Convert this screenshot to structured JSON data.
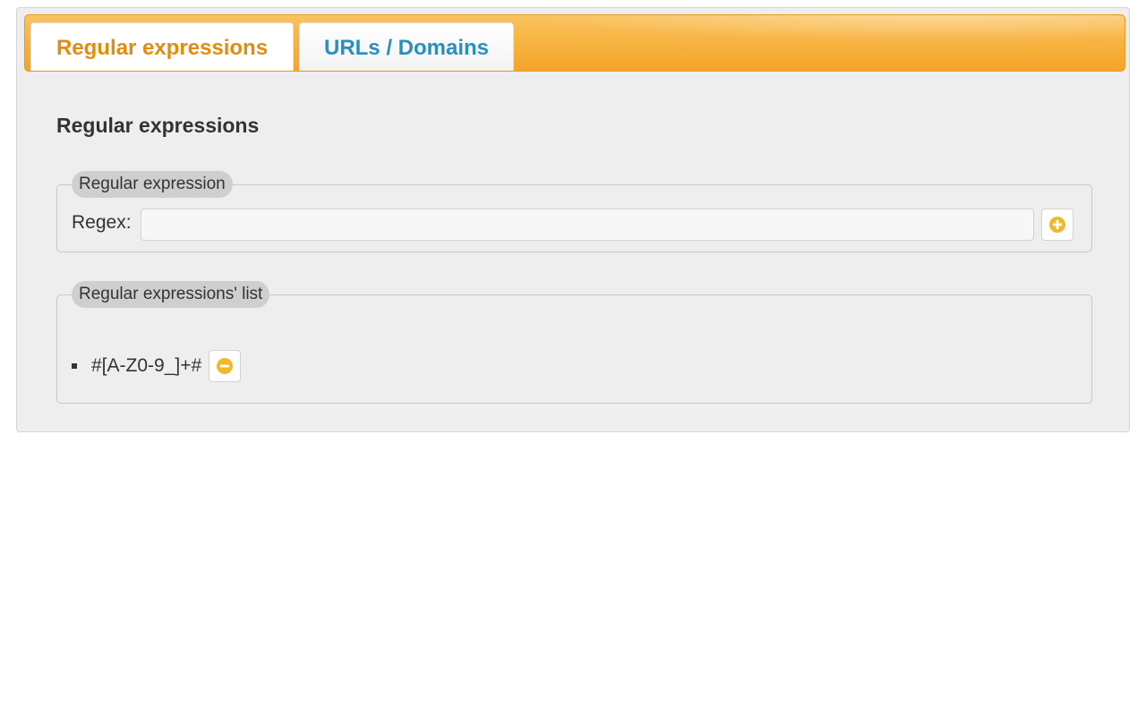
{
  "tabs": [
    {
      "label": "Regular expressions",
      "active": true
    },
    {
      "label": "URLs / Domains",
      "active": false
    }
  ],
  "panel": {
    "title": "Regular expressions"
  },
  "regex_form": {
    "legend": "Regular expression",
    "label": "Regex:",
    "value": "",
    "placeholder": "",
    "add_icon": "plus-circle-icon"
  },
  "regex_list": {
    "legend": "Regular expressions' list",
    "items": [
      {
        "text": "#[A-Z0-9_]+#",
        "remove_icon": "minus-circle-icon"
      }
    ]
  },
  "colors": {
    "tabbar": "#f7b443",
    "active_tab_text": "#e58c0a",
    "inactive_tab_text": "#2a8fbd",
    "icon_accent": "#f1b82d"
  }
}
